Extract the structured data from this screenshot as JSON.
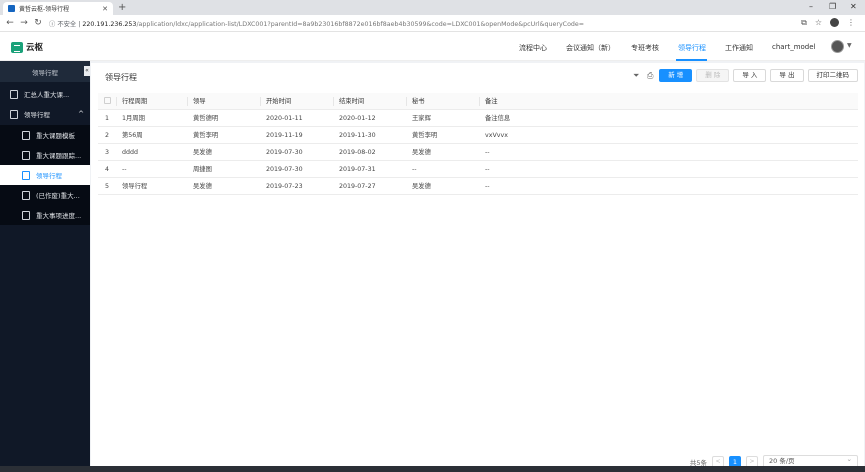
{
  "browser": {
    "tab_title": "黄哲云枢-领导行程",
    "new_tab": "+",
    "insecure_label": "不安全",
    "url_host": "220.191.236.253",
    "url_path": "/application/ldxc/application-list/LDXC001?parentId=8a9b23016bf8872e016bf8aeb4b30599&code=LDXC001&openMode&pcUrl&queryCode="
  },
  "app": {
    "logo_text": "云枢",
    "nav": [
      "流程中心",
      "会议通知（新）",
      "专班考核",
      "领导行程",
      "工作通知",
      "chart_model"
    ],
    "active_nav": "领导行程"
  },
  "sidebar": {
    "header": "领导行程",
    "collapse": "«",
    "items": [
      {
        "label": "汇总人重大课..."
      },
      {
        "label": "领导行程"
      },
      {
        "label": "重大课题模板"
      },
      {
        "label": "重大课题跟踪..."
      },
      {
        "label": "领导行程"
      },
      {
        "label": "(已作废)重大..."
      },
      {
        "label": "重大事项进度..."
      }
    ]
  },
  "panel": {
    "title": "领导行程",
    "buttons": {
      "new": "新 增",
      "delete": "删 除",
      "import": "导 入",
      "export": "导 出",
      "qrcode": "打印二维码"
    }
  },
  "table": {
    "headers": [
      "",
      "行程周期",
      "领导",
      "开始时间",
      "结束时间",
      "秘书",
      "备注"
    ],
    "rows": [
      [
        "1",
        "1月周期",
        "黄哲德明",
        "2020-01-11",
        "2020-01-12",
        "王家辉",
        "备注信息"
      ],
      [
        "2",
        "第56周",
        "黄哲李明",
        "2019-11-19",
        "2019-11-30",
        "黄哲李明",
        "vxVvvx"
      ],
      [
        "3",
        "dddd",
        "吴发德",
        "2019-07-30",
        "2019-08-02",
        "吴发德",
        "--"
      ],
      [
        "4",
        "--",
        "周捷图",
        "2019-07-30",
        "2019-07-31",
        "--",
        "--"
      ],
      [
        "5",
        "领导行程",
        "吴发德",
        "2019-07-23",
        "2019-07-27",
        "吴发德",
        "--"
      ]
    ]
  },
  "pagination": {
    "total": "共5条",
    "prev": "<",
    "current": "1",
    "next": ">",
    "page_size": "20 条/页"
  }
}
